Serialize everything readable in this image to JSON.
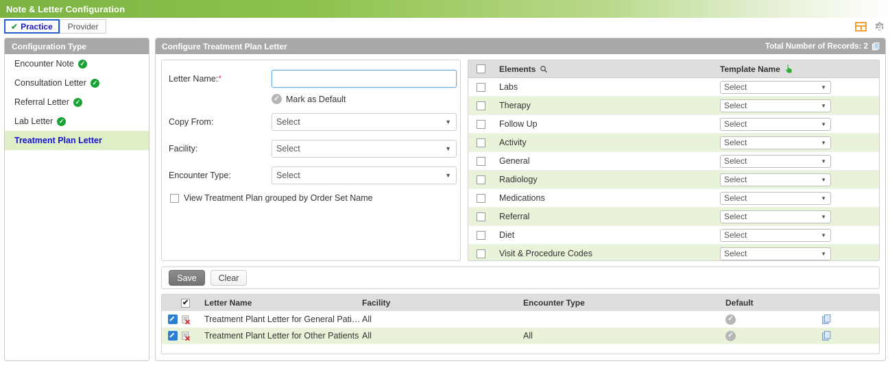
{
  "app": {
    "title": "Note & Letter Configuration"
  },
  "tabs": [
    {
      "label": "Practice",
      "active": true,
      "check": "✔"
    },
    {
      "label": "Provider",
      "active": false
    }
  ],
  "toolbar": {
    "layout_icon": "layout-icon",
    "gear_icon": "gear-icon"
  },
  "sidebar": {
    "header": "Configuration Type",
    "items": [
      {
        "label": "Encounter Note",
        "configured": true,
        "selected": false
      },
      {
        "label": "Consultation Letter",
        "configured": true,
        "selected": false
      },
      {
        "label": "Referral Letter",
        "configured": true,
        "selected": false
      },
      {
        "label": "Lab Letter",
        "configured": true,
        "selected": false
      },
      {
        "label": "Treatment Plan Letter",
        "configured": false,
        "selected": true
      }
    ]
  },
  "content": {
    "header": "Configure Treatment Plan Letter",
    "records_label": "Total Number of Records: 2"
  },
  "form": {
    "letter_name_label": "Letter Name:",
    "letter_name_required": "*",
    "letter_name_value": "",
    "letter_name_placeholder": "",
    "mark_as_default_label": "Mark as Default",
    "copy_from_label": "Copy From:",
    "copy_from_value": "Select",
    "facility_label": "Facility:",
    "facility_value": "Select",
    "encounter_type_label": "Encounter Type:",
    "encounter_type_value": "Select",
    "group_by_order_set_label": "View Treatment Plan grouped by Order Set Name",
    "group_by_order_set_checked": false
  },
  "buttons": {
    "save_label": "Save",
    "clear_label": "Clear"
  },
  "elements_grid": {
    "columns": {
      "elements": "Elements",
      "template_name": "Template Name"
    },
    "rows": [
      {
        "name": "Labs",
        "template": "Select",
        "checked": false
      },
      {
        "name": "Therapy",
        "template": "Select",
        "checked": false
      },
      {
        "name": "Follow Up",
        "template": "Select",
        "checked": false
      },
      {
        "name": "Activity",
        "template": "Select",
        "checked": false
      },
      {
        "name": "General",
        "template": "Select",
        "checked": false
      },
      {
        "name": "Radiology",
        "template": "Select",
        "checked": false
      },
      {
        "name": "Medications",
        "template": "Select",
        "checked": false
      },
      {
        "name": "Referral",
        "template": "Select",
        "checked": false
      },
      {
        "name": "Diet",
        "template": "Select",
        "checked": false
      },
      {
        "name": "Visit & Procedure Codes",
        "template": "Select",
        "checked": false
      }
    ]
  },
  "results_table": {
    "columns": {
      "letter_name": "Letter Name",
      "facility": "Facility",
      "encounter_type": "Encounter Type",
      "default": "Default"
    },
    "header_checked": true,
    "rows": [
      {
        "letter_name": "Treatment Plant Letter for General Patie...",
        "facility": "All",
        "encounter_type": "",
        "is_default": true
      },
      {
        "letter_name": "Treatment Plant Letter for Other Patients",
        "facility": "All",
        "encounter_type": "All",
        "is_default": true
      }
    ]
  },
  "colors": {
    "header_green": "#8dc24c",
    "panel_gray": "#a8a8a8",
    "row_alt_green": "#e9f3da",
    "selected_text_blue": "#1414cc",
    "accent_blue": "#2a7fd4",
    "check_green": "#17a336",
    "required_red": "#e05050",
    "orange_icon": "#f0a030"
  }
}
